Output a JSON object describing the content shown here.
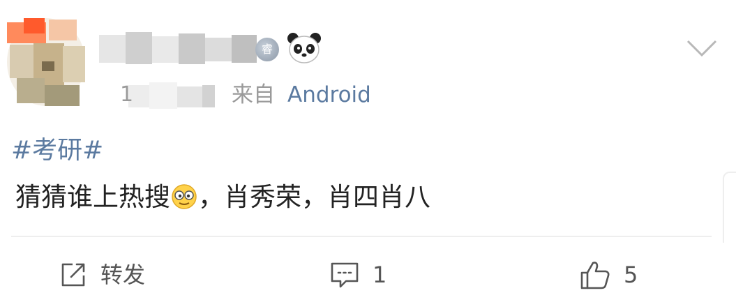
{
  "header": {
    "vip_badge_glyph": "睿",
    "panda_icon": "panda-emoji-icon",
    "time_leading_char": "1",
    "source_prefix": "来自",
    "source_name": "Android",
    "menu_icon": "chevron-down-icon"
  },
  "post": {
    "hashtag": "#考研#",
    "text_before_emoji": "猜猜谁上热搜",
    "emoji": "grin-emoji-icon",
    "text_after_emoji": "，肖秀荣，肖四肖八"
  },
  "actions": {
    "repost_label": "转发",
    "comment_count": "1",
    "like_count": "5"
  },
  "colors": {
    "link": "#5b7aa0",
    "text": "#222222",
    "muted": "#9a9a9a"
  }
}
